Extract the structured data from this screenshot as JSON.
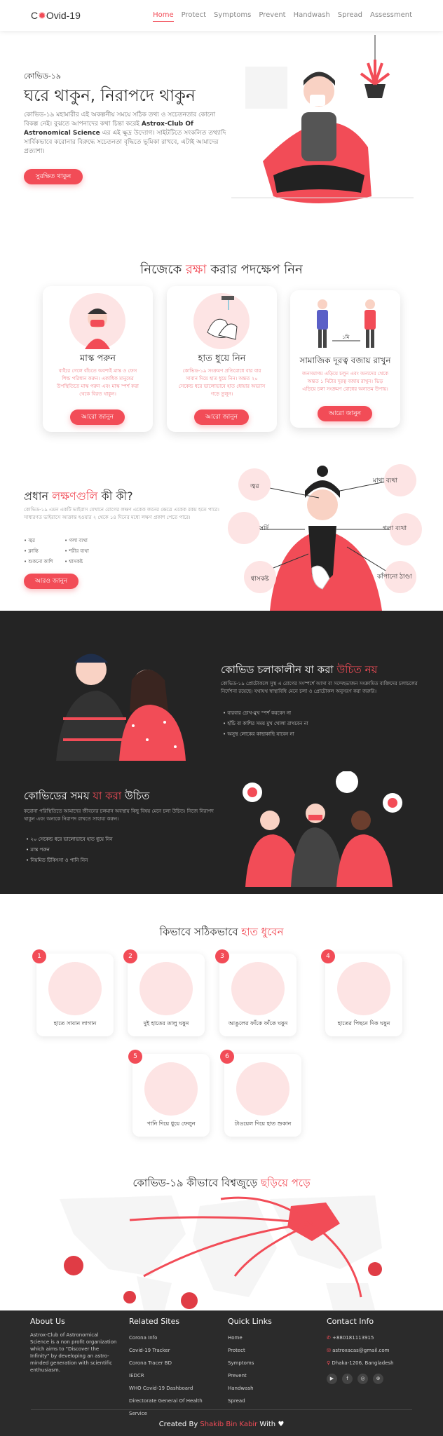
{
  "brand": {
    "logo_pre": "C",
    "logo_post": "Ovid-19"
  },
  "nav": [
    "Home",
    "Protect",
    "Symptoms",
    "Prevent",
    "Handwash",
    "Spread",
    "Assessment"
  ],
  "hero": {
    "kicker": "কোভিড-১৯",
    "title": "ঘরে থাকুন, নিরাপদে থাকুন",
    "text": "কোভিড-১৯ মহামারীর এই অকল্পনীয় সময়ে সঠিক তথ্য ও সচেতনতার কোনো বিকল্প নেই। বুঝতে আপনাদের কথা চিন্তা করেই",
    "org": "Astrox-Club Of Astronomical Science",
    "text2": "এর এই ক্ষুদ্র উদ্যোগ। সাইটটিতে সংকলিত তথ্যাদি সার্বিকভাবে করোনার বিরুদ্ধে সচেতনতা বৃদ্ধিতে ভূমিকা রাখবে, এটাই আমাদের প্রত্যাশা।",
    "button": "সুরক্ষিত থাকুন"
  },
  "protect": {
    "title_a": "নিজেকে ",
    "title_b": "রক্ষা",
    "title_c": " করার পদক্ষেপ নিন",
    "cards": [
      {
        "title": "মাস্ক পরুন",
        "text": "বাইরে গেলে বাঁচতে অবশ্যই মাস্ক ও ফেস শিল্ড পরিধান করুন। একাধিক মানুষের উপস্থিতিতে মাস্ক পরুন এবং মাস্ক স্পর্শ করা থেকে বিরত থাকুন।",
        "button": "আরো জানুন"
      },
      {
        "title": "হাত ধুয়ে নিন",
        "text": "কোভিড-১৯ সংক্রমণ প্রতিরোধে বার বার সাবান দিয়ে হাত ধুয়ে নিন। অন্তত ২০ সেকেন্ড ধরে ভালোভাবে হাত ধোয়ার অভ্যাস গড়ে তুলুন।",
        "button": "আরো জানুন"
      },
      {
        "title": "সামাজিক দূরত্ব বজায় রাখুন",
        "text": "জনসমাগম এড়িয়ে চলুন এবং অন্যদের থেকে অন্তত ১ মিটার দূরত্ব বজায় রাখুন। ভিড় এড়িয়ে চলা সংক্রমণ রোধের অন্যতম উপায়।",
        "button": "আরো জানুন",
        "distance": "১মি"
      }
    ]
  },
  "symptoms": {
    "title_a": "প্রধান ",
    "title_b": "লক্ষণগুলি",
    "title_c": " কী কী?",
    "text": "কোভিড-১৯ এমন একটি ভাইরাস যেখানে রোগের লক্ষণ একেক জনের ক্ষেত্রে একেক রকম হতে পারে। সাধারণত ভাইরাসে আক্রান্ত হওয়ার ২ থেকে ১৪ দিনের মধ্যে লক্ষণ প্রকাশ পেতে পারে।",
    "list1": [
      "জ্বর",
      "ক্লান্তি",
      "শুকনো কাশি"
    ],
    "list2": [
      "গলা ব্যথা",
      "শরীর ব্যথা",
      "শ্বাসকষ্ট"
    ],
    "button": "আরও জানুন",
    "labels": [
      "জ্বর",
      "মাথা ব্যথা",
      "সর্দি",
      "গলা ব্যথা",
      "শ্বাসকষ্ট",
      "কাঁপানো ঠাণ্ডা"
    ]
  },
  "dont": {
    "title_a": "কোভিড চলাকালীন যা করা ",
    "title_b": "উচিত নয়",
    "text": "কোভিড-১৯ প্রোটোকলে সুস্থ এ রোগের সংস্পর্শে আসা বা সন্দেহভাজন সংক্রামিত ব্যক্তিদের চলাচলের নির্দেশনা রয়েছে। যথাযথ স্বাস্থ্যবিধি মেনে চলা ও প্রোটোকল অনুসরণ করা জরুরি।",
    "list": [
      "বারবার চোখ-মুখ স্পর্শ করবেন না",
      "হাঁচি বা কাশির সময় মুখ খোলা রাখবেন না",
      "অসুস্থ লোকের কাছাকাছি যাবেন না"
    ]
  },
  "do": {
    "title_a": "কোভিডের সময় ",
    "title_b": "যা করা",
    "title_c": " উচিত",
    "text": "করোনা পরিস্থিতিতে আমাদের জীবনের চলমান অবস্থায় কিছু বিষয় মেনে চলা উচিত। নিজে নিরাপদ থাকুন এবং অন্যকে নিরাপদ রাখতে সাহায্য করুন।",
    "list": [
      "২০ সেকেন্ড ধরে ভালোভাবে হাত ধুয়ে নিন",
      "মাস্ক পরুন",
      "নিয়মিত টিকিৎসা ও পানি নিন"
    ]
  },
  "handwash": {
    "title_a": "কিভাবে সঠিকভাবে ",
    "title_b": "হাত ধুবেন",
    "steps": [
      {
        "n": "1",
        "label": "হাতে সাবান লাগান"
      },
      {
        "n": "2",
        "label": "দুই হাতের তালু ঘষুন"
      },
      {
        "n": "3",
        "label": "আঙুলের ফাঁকে ফাঁকে ঘষুন"
      },
      {
        "n": "4",
        "label": "হাতের পিছনে দিক ঘষুন"
      },
      {
        "n": "5",
        "label": "পানি দিয়ে ধুয়ে ফেলুন"
      },
      {
        "n": "6",
        "label": "টাওয়েল দিয়ে হাত শুকান"
      }
    ]
  },
  "spread": {
    "title_a": "কোভিড-১৯ কীভাবে বিশ্বজুড়ে ",
    "title_b": "ছড়িয়ে পড়ে"
  },
  "footer": {
    "about": {
      "title": "About Us",
      "text": "Astrox-Club of Astronomical Science is a non profit organization which aims to \"Discover the Infinity\" by developing an astro-minded generation with scientific enthusiasm."
    },
    "related": {
      "title": "Related Sites",
      "links": [
        "Corona Info",
        "Covid-19 Tracker",
        "Corona Tracer BD",
        "IEDCR",
        "WHO Covid-19 Dashboard",
        "Directorate General Of Health Service"
      ]
    },
    "quick": {
      "title": "Quick Links",
      "links": [
        "Home",
        "Protect",
        "Symptoms",
        "Prevent",
        "Handwash",
        "Spread"
      ]
    },
    "contact": {
      "title": "Contact Info",
      "phone": "+880181113915",
      "email": "astroxacas@gmail.com",
      "address": "Dhaka-1206, Bangladesh"
    },
    "credit_a": "Created By ",
    "credit_b": "Shakib Bin Kabir",
    "credit_c": " With"
  },
  "colors": {
    "accent": "#f24c57",
    "dark": "#242424",
    "footer": "#2b2b2b"
  }
}
